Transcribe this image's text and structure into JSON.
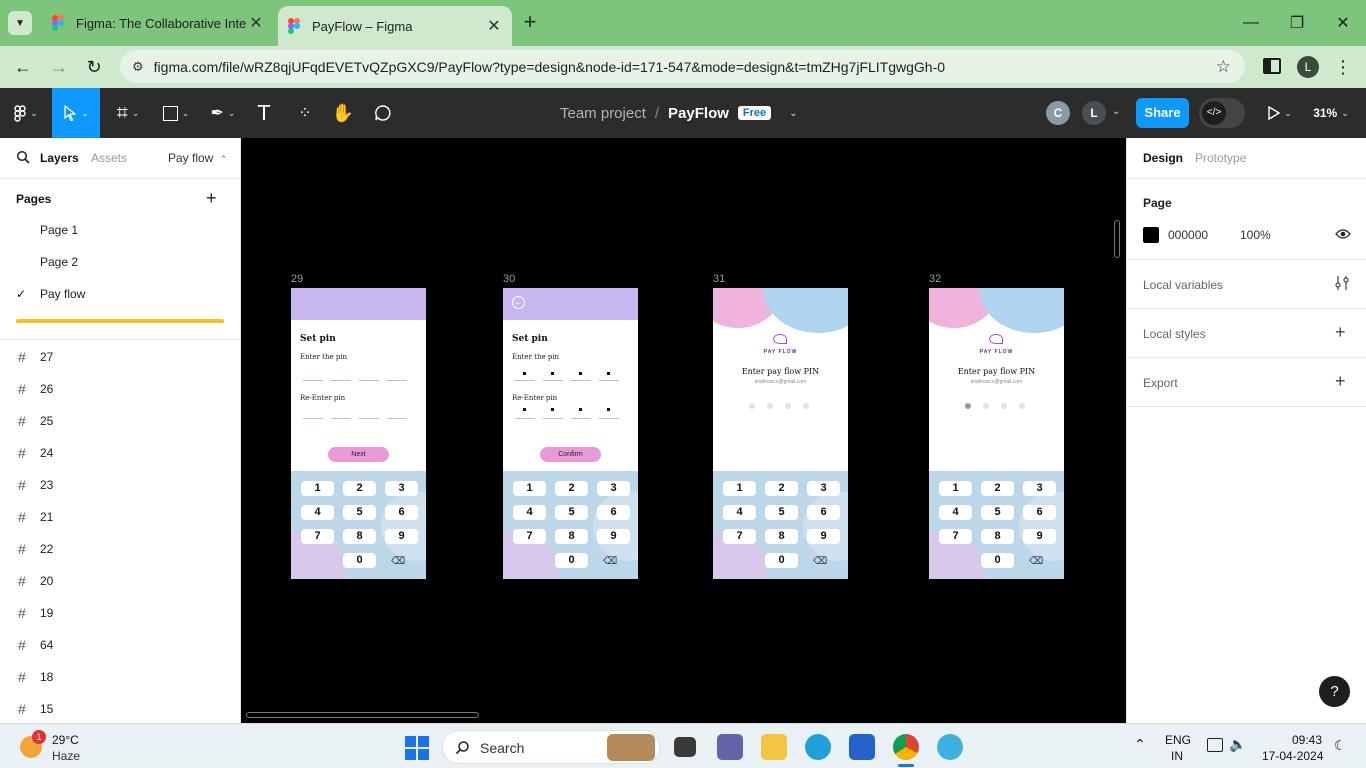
{
  "browser": {
    "tabs": [
      {
        "title": "Figma: The Collaborative Interf",
        "active": false
      },
      {
        "title": "PayFlow – Figma",
        "active": true
      }
    ],
    "url": "figma.com/file/wRZ8qjUFqdEVETvQZpGXC9/PayFlow?type=design&node-id=171-547&mode=design&t=tmZHg7jFLITgwgGh-0",
    "profile_initial": "L"
  },
  "figma": {
    "breadcrumb": {
      "team": "Team project",
      "separator": "/",
      "file": "PayFlow",
      "plan_badge": "Free"
    },
    "avatars": [
      "C",
      "L"
    ],
    "share_label": "Share",
    "zoom": "31%",
    "left_panel": {
      "tabs": [
        "Layers",
        "Assets"
      ],
      "page_selector": "Pay flow",
      "pages_heading": "Pages",
      "pages": [
        {
          "name": "Page 1",
          "selected": false
        },
        {
          "name": "Page 2",
          "selected": false
        },
        {
          "name": "Pay flow",
          "selected": true
        }
      ],
      "frames": [
        "27",
        "26",
        "25",
        "24",
        "23",
        "21",
        "22",
        "20",
        "19",
        "64",
        "18",
        "15"
      ]
    },
    "canvas": {
      "frames": [
        {
          "label": "29",
          "type": "set-pin",
          "title": "Set pin",
          "enter_label": "Enter the pin",
          "reenter_label": "Re-Enter pin",
          "button": "Next",
          "filled": false,
          "back": false
        },
        {
          "label": "30",
          "type": "set-pin",
          "title": "Set pin",
          "enter_label": "Enter the pin",
          "reenter_label": "Re-Enter pin",
          "button": "Confirm",
          "filled": true,
          "back": true
        },
        {
          "label": "31",
          "type": "enter-pin",
          "logo": "PAY FLOW",
          "title": "Enter pay flow PIN",
          "email": "krishnaxcx@gmail.com",
          "entered": 0
        },
        {
          "label": "32",
          "type": "enter-pin",
          "logo": "PAY FLOW",
          "title": "Enter pay flow PIN",
          "email": "krishnaxcx@gmail.com",
          "entered": 1
        }
      ],
      "keypad": [
        "1",
        "2",
        "3",
        "4",
        "5",
        "6",
        "7",
        "8",
        "9",
        "0"
      ]
    },
    "right_panel": {
      "tabs": [
        "Design",
        "Prototype"
      ],
      "page_heading": "Page",
      "page_color_hex": "000000",
      "page_opacity": "100%",
      "sections": [
        "Local variables",
        "Local styles",
        "Export"
      ],
      "help": "?"
    }
  },
  "taskbar": {
    "weather": {
      "temp": "29°C",
      "condition": "Haze",
      "badge": "1"
    },
    "search_placeholder": "Search",
    "lang": {
      "line1": "ENG",
      "line2": "IN"
    },
    "time": "09:43",
    "date": "17-04-2024"
  },
  "colors": {
    "chrome_frame": "#7dc47d",
    "figma_toolbar": "#2c2c2c",
    "share_button": "#0d99ff",
    "pin_header": "#c6b8ef",
    "button_pink": "#e89ad8",
    "keypad_bg": "#bcd6ea"
  }
}
